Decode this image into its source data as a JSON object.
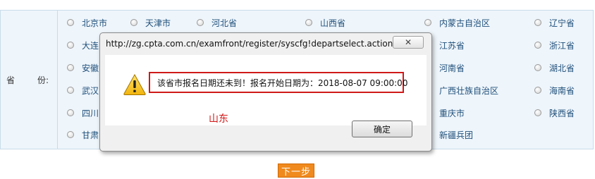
{
  "form": {
    "province_label_a": "省",
    "province_label_b": "份:",
    "options": [
      "北京市",
      "天津市",
      "河北省",
      "山西省",
      "内蒙古自治区",
      "辽宁省",
      "大连",
      "江苏省",
      "浙江省",
      "安徽",
      "河南省",
      "湖北省",
      "武汉",
      "广西壮族自治区",
      "海南省",
      "四川",
      "重庆市",
      "陕西省",
      "甘肃",
      "新疆兵团"
    ]
  },
  "dialog": {
    "title": "http://zg.cpta.com.cn/examfront/register/syscfg!departselect.action?...",
    "close_label": "✕",
    "message": "该省市报名日期还未到！报名开始日期为：2018-08-07 09:00:00",
    "ok_label": "确定"
  },
  "annotation": {
    "text": "山东",
    "color": "#d01919"
  },
  "next_button": {
    "label": "下一步"
  },
  "colors": {
    "accent": "#f08a1e",
    "link": "#1f4f7a",
    "highlight": "#d01919"
  }
}
